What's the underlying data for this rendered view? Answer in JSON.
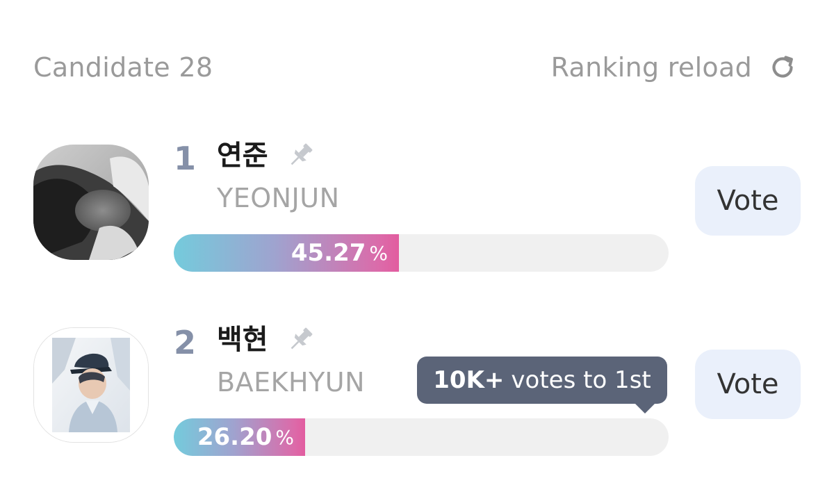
{
  "header": {
    "candidate_count": "Candidate 28",
    "reload_label": "Ranking reload",
    "reload_icon": "refresh-icon"
  },
  "candidates": [
    {
      "rank": "1",
      "name_kr": "연준",
      "name_en": "YEONJUN",
      "percent_value": "45.27",
      "percent_unit": "%",
      "share_percent": 45.27,
      "vote_label": "Vote",
      "pin_icon": "pin-icon"
    },
    {
      "rank": "2",
      "name_kr": "백현",
      "name_en": "BAEKHYUN",
      "percent_value": "26.20",
      "percent_unit": "%",
      "share_percent": 26.2,
      "vote_label": "Vote",
      "pin_icon": "pin-icon",
      "tooltip_strong": "10K+",
      "tooltip_text": "votes to 1st"
    }
  ],
  "colors": {
    "bar_start": "#74cbdc",
    "bar_end": "#e25c9f",
    "vote_button_bg": "#eaf0fb",
    "tooltip_bg": "#5b6478",
    "rank_color": "#8590a8"
  }
}
